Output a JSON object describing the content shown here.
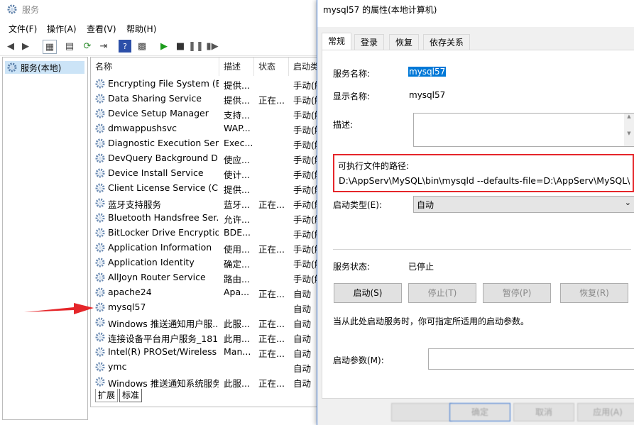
{
  "window": {
    "title": "服务"
  },
  "menu": [
    "文件(F)",
    "操作(A)",
    "查看(V)",
    "帮助(H)"
  ],
  "tree": {
    "root": "服务(本地)"
  },
  "columns": [
    "名称",
    "描述",
    "状态",
    "启动类"
  ],
  "services": [
    {
      "name": "Encrypting File System (E...",
      "desc": "提供...",
      "status": "",
      "startup": "手动(触"
    },
    {
      "name": "Data Sharing Service",
      "desc": "提供...",
      "status": "正在...",
      "startup": "手动(触"
    },
    {
      "name": "Device Setup Manager",
      "desc": "支持...",
      "status": "",
      "startup": "手动(触"
    },
    {
      "name": "dmwappushsvc",
      "desc": "WAP...",
      "status": "",
      "startup": "手动(触"
    },
    {
      "name": "Diagnostic Execution Ser...",
      "desc": "Exec...",
      "status": "",
      "startup": "手动(触"
    },
    {
      "name": "DevQuery Background D...",
      "desc": "使应...",
      "status": "",
      "startup": "手动(触"
    },
    {
      "name": "Device Install Service",
      "desc": "使计...",
      "status": "",
      "startup": "手动(触"
    },
    {
      "name": "Client License Service (Cli...",
      "desc": "提供...",
      "status": "",
      "startup": "手动(触"
    },
    {
      "name": "蓝牙支持服务",
      "desc": "蓝牙...",
      "status": "正在...",
      "startup": "手动(触"
    },
    {
      "name": "Bluetooth Handsfree Ser...",
      "desc": "允许...",
      "status": "",
      "startup": "手动(触"
    },
    {
      "name": "BitLocker Drive Encryptio...",
      "desc": "BDE...",
      "status": "",
      "startup": "手动(触"
    },
    {
      "name": "Application Information",
      "desc": "使用...",
      "status": "正在...",
      "startup": "手动(触"
    },
    {
      "name": "Application Identity",
      "desc": "确定...",
      "status": "",
      "startup": "手动(触"
    },
    {
      "name": "AllJoyn Router Service",
      "desc": "路由...",
      "status": "",
      "startup": "手动(触"
    },
    {
      "name": "apache24",
      "desc": "Apa...",
      "status": "正在...",
      "startup": "自动"
    },
    {
      "name": "mysql57",
      "desc": "",
      "status": "",
      "startup": "自动"
    },
    {
      "name": "Windows 推送通知用户服...",
      "desc": "此服...",
      "status": "正在...",
      "startup": "自动"
    },
    {
      "name": "连接设备平台用户服务_181...",
      "desc": "此用...",
      "status": "正在...",
      "startup": "自动"
    },
    {
      "name": "Intel(R) PROSet/Wireless ...",
      "desc": "Man...",
      "status": "正在...",
      "startup": "自动"
    },
    {
      "name": "ymc",
      "desc": "",
      "status": "",
      "startup": "自动"
    },
    {
      "name": "Windows 推送通知系统服务",
      "desc": "此服...",
      "status": "正在...",
      "startup": "自动"
    }
  ],
  "bottom_tabs": [
    "扩展",
    "标准"
  ],
  "dialog": {
    "title": "mysql57 的属性(本地计算机)",
    "tabs": [
      "常规",
      "登录",
      "恢复",
      "依存关系"
    ],
    "service_name_label": "服务名称:",
    "service_name": "mysql57",
    "display_name_label": "显示名称:",
    "display_name": "mysql57",
    "description_label": "描述:",
    "path_label": "可执行文件的路径:",
    "path": "D:\\AppServ\\MySQL\\bin\\mysqld --defaults-file=D:\\AppServ\\MySQL\\my.ini",
    "startup_type_label": "启动类型(E):",
    "startup_type": "自动",
    "status_label": "服务状态:",
    "status": "已停止",
    "buttons": [
      "启动(S)",
      "停止(T)",
      "暂停(P)",
      "恢复(R)"
    ],
    "hint": "当从此处启动服务时，你可指定所适用的启动参数。",
    "param_label": "启动参数(M):",
    "footer_buttons": [
      "确定",
      "取消",
      "应用(A)"
    ]
  },
  "colors": {
    "highlight": "#0078d7",
    "path_border": "#e5262a",
    "arrow": "#e5262a"
  }
}
